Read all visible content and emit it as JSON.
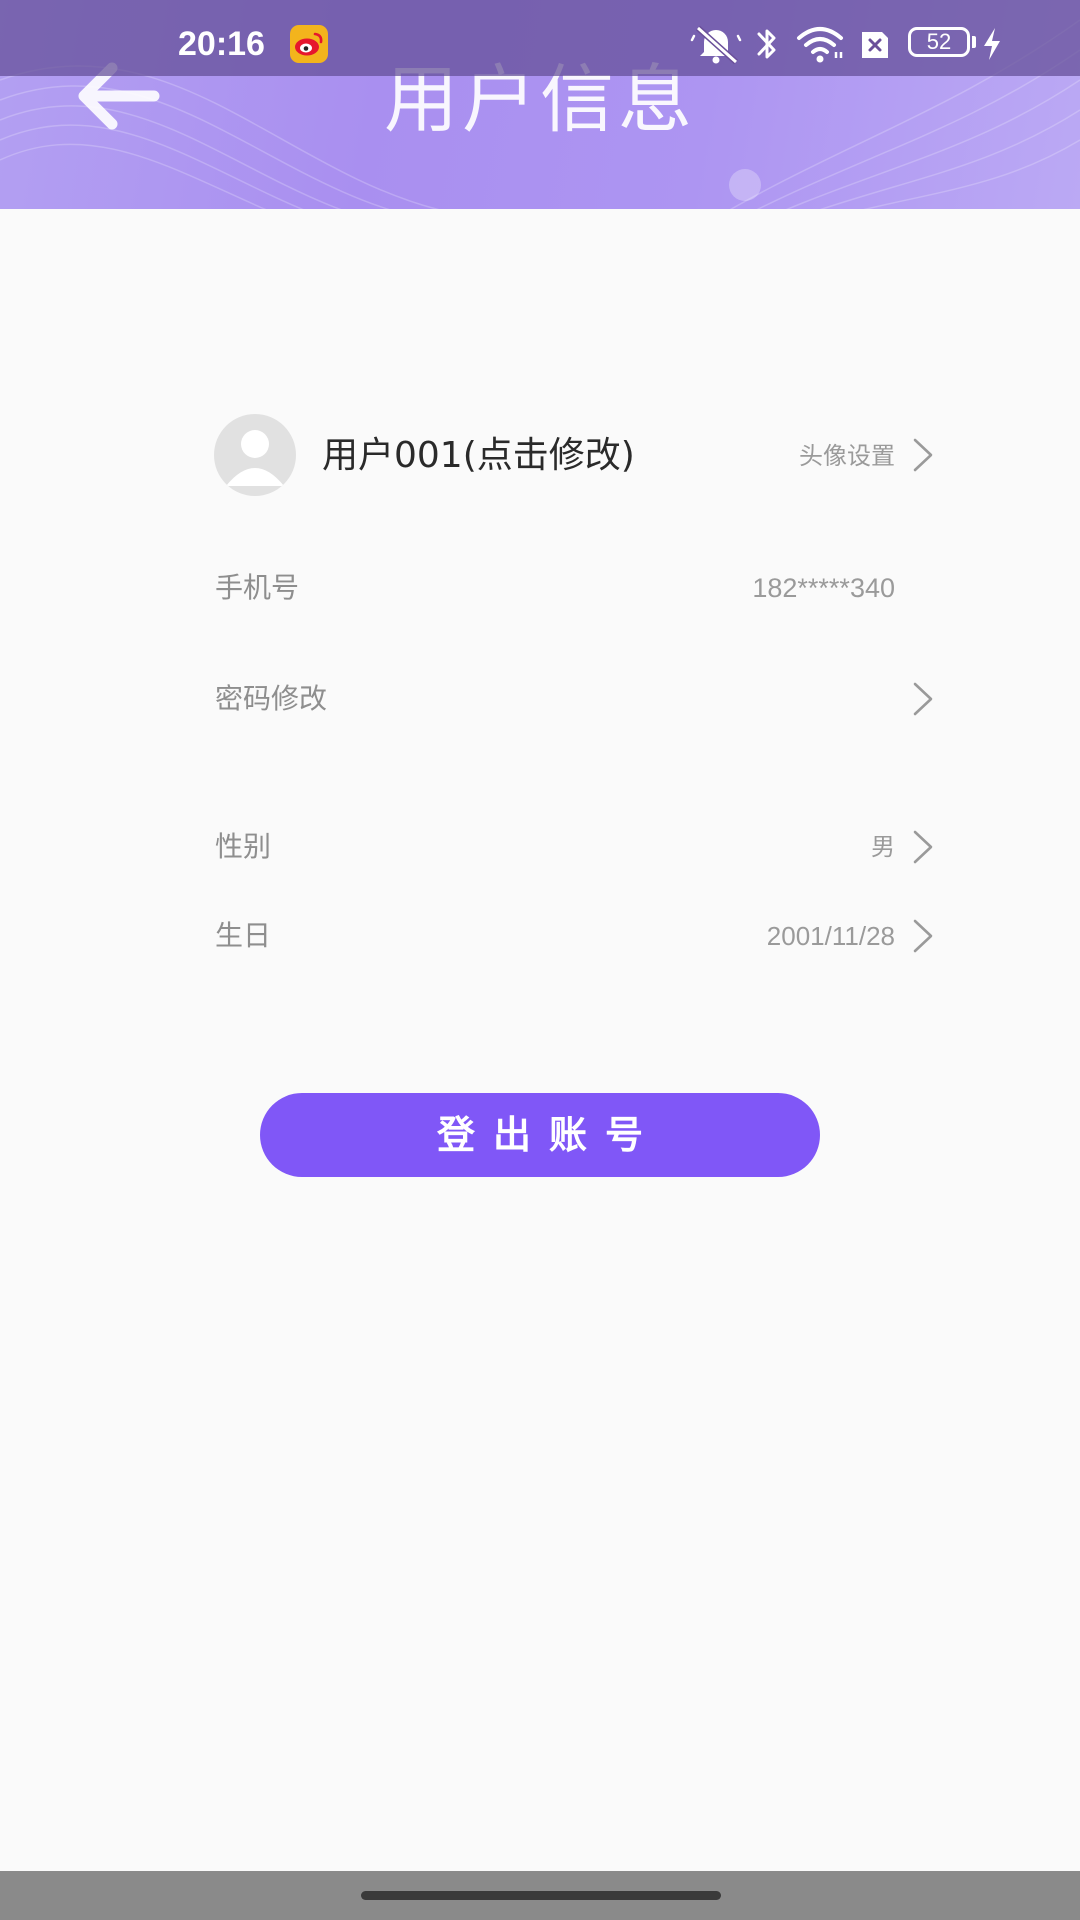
{
  "status_bar": {
    "time": "20:16",
    "battery_level": "52",
    "icons": [
      "weibo-icon",
      "bell-muted-icon",
      "bluetooth-icon",
      "wifi-icon",
      "sim-x-icon",
      "battery-icon",
      "charging-icon"
    ]
  },
  "header": {
    "title": "用户信息",
    "back_icon": "arrow-left-icon"
  },
  "profile": {
    "username": "用户001(点击修改)",
    "avatar_setting_label": "头像设置"
  },
  "fields": {
    "phone": {
      "label": "手机号",
      "value": "182*****340"
    },
    "password": {
      "label": "密码修改"
    },
    "gender": {
      "label": "性别",
      "value": "男"
    },
    "birthday": {
      "label": "生日",
      "value": "2001/11/28"
    }
  },
  "logout_button_label": "登出账号",
  "colors": {
    "accent": "#8057f7",
    "header": "#ad95f2",
    "background": "#fafafa",
    "label_text": "#8e8e8e"
  }
}
